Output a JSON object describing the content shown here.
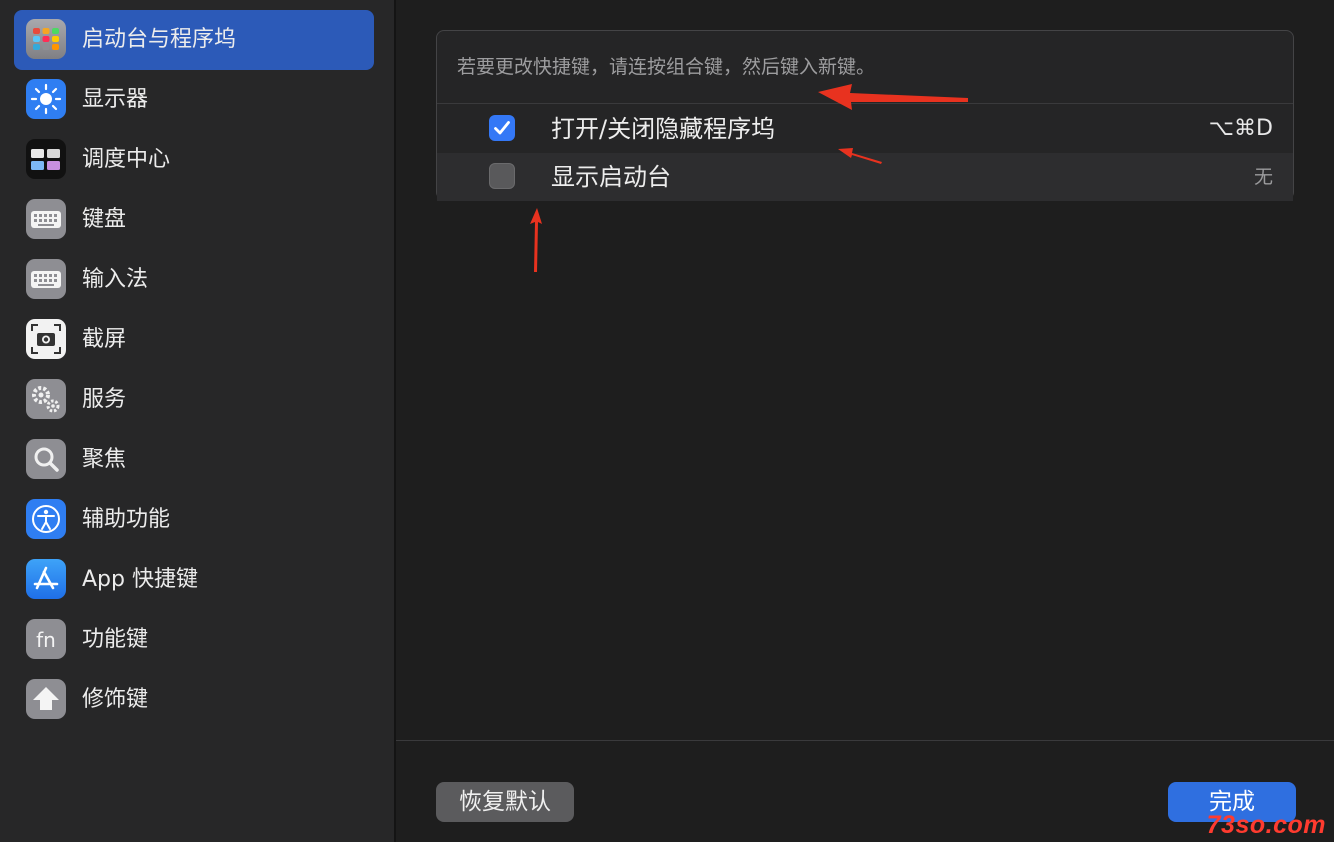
{
  "sidebar": {
    "items": [
      {
        "label": "启动台与程序坞",
        "icon": "launchpad-dock-icon",
        "selected": true
      },
      {
        "label": "显示器",
        "icon": "display-sun-icon"
      },
      {
        "label": "调度中心",
        "icon": "mission-control-icon"
      },
      {
        "label": "键盘",
        "icon": "keyboard-icon"
      },
      {
        "label": "输入法",
        "icon": "input-source-keyboard-icon"
      },
      {
        "label": "截屏",
        "icon": "screenshot-camera-icon"
      },
      {
        "label": "服务",
        "icon": "services-gear-icon"
      },
      {
        "label": "聚焦",
        "icon": "spotlight-search-icon"
      },
      {
        "label": "辅助功能",
        "icon": "accessibility-icon"
      },
      {
        "label": "App 快捷键",
        "icon": "app-store-icon"
      },
      {
        "label": "功能键",
        "icon": "fn-key-icon"
      },
      {
        "label": "修饰键",
        "icon": "modifier-up-arrow-icon"
      }
    ]
  },
  "main": {
    "hint": "若要更改快捷键，请连按组合键，然后键入新键。",
    "shortcuts": [
      {
        "label": "打开/关闭隐藏程序坞",
        "key": "⌥⌘D",
        "checked": true
      },
      {
        "label": "显示启动台",
        "key": "无",
        "checked": false
      }
    ]
  },
  "footer": {
    "restore_label": "恢复默认",
    "done_label": "完成"
  },
  "watermark": "73so.com",
  "colors": {
    "accent": "#2c5ab8",
    "checkbox_on": "#3478f6",
    "annotation_arrow": "#e8321f"
  }
}
